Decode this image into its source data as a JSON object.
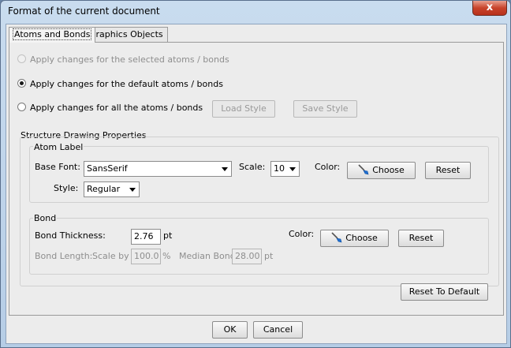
{
  "window": {
    "title": "Format of the current document",
    "close_glyph": "x"
  },
  "tabs": [
    {
      "label": "Atoms and Bonds"
    },
    {
      "label": "Graphics Objects"
    }
  ],
  "apply": {
    "selected": "Apply changes for the selected atoms / bonds",
    "default": "Apply changes for the default atoms / bonds",
    "all": "Apply changes for all the atoms / bonds",
    "checked": "default"
  },
  "style_buttons": {
    "load": "Load Style",
    "save": "Save Style"
  },
  "structure": {
    "title": "Structure Drawing Properties"
  },
  "atom_label": {
    "title": "Atom Label",
    "base_font_label": "Base Font:",
    "base_font_value": "SansSerif",
    "scale_label": "Scale:",
    "scale_value": "10",
    "color_label": "Color:",
    "choose": "Choose",
    "reset": "Reset",
    "style_label": "Style:",
    "style_value": "Regular"
  },
  "bond": {
    "title": "Bond",
    "thickness_label": "Bond Thickness:",
    "thickness_value": "2.76",
    "thickness_unit": "pt",
    "color_label": "Color:",
    "choose": "Choose",
    "reset": "Reset",
    "length_label": "Bond Length:",
    "scale_by_label": "Scale by",
    "scale_by_value": "100.0",
    "scale_by_unit": "%",
    "median_label": "Median Bond",
    "median_value": "28.00",
    "median_unit": "pt"
  },
  "reset_default": "Reset To Default",
  "footer": {
    "ok": "OK",
    "cancel": "Cancel"
  },
  "icons": {
    "brush": "paint-brush-icon",
    "brush_color": "#1f6fd1"
  }
}
